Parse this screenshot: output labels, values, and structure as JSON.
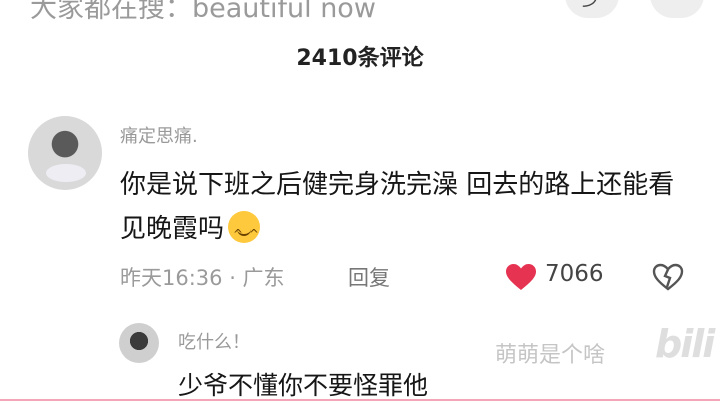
{
  "header": {
    "search_hint": "大家都在搜：beautiful now",
    "count_label": "2410条评论"
  },
  "comment": {
    "username": "痛定思痛.",
    "text": "你是说下班之后健完身洗完澡 回去的路上还能看见晚霞吗",
    "emoji": "smile-emoji",
    "time": "昨天16:36 · 广东",
    "reply_label": "回复",
    "like_count": "7066",
    "like_color": "#e63352"
  },
  "sub_reply": {
    "username": "吃什么！",
    "text": "少爷不懂你不要怪罪他"
  },
  "watermark": {
    "text": "萌萌是个啥",
    "logo": "bili"
  }
}
